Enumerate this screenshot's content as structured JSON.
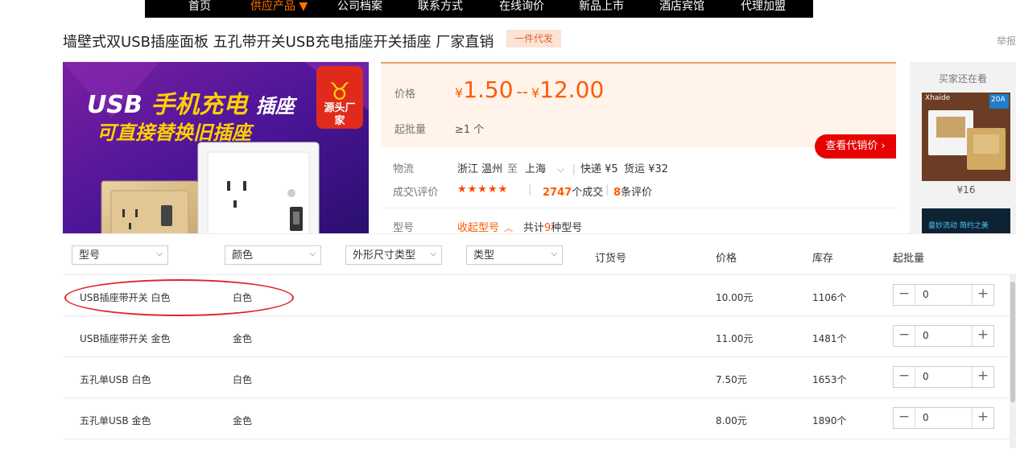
{
  "nav": [
    "首页",
    "供应产品 ▼",
    "公司档案",
    "联系方式",
    "在线询价",
    "新品上市",
    "酒店宾馆",
    "代理加盟"
  ],
  "title": "墙壁式双USB插座面板 五孔带开关USB充电插座开关插座 厂家直销",
  "badge": "一件代发",
  "report": "举报",
  "banner": {
    "line1_a": "USB",
    "line1_b": "手机充电",
    "line1_c": "插座",
    "line2": "可直接替换旧插座",
    "tag": "源头厂家"
  },
  "price": {
    "label": "价格",
    "currency": "¥",
    "min": "1.50",
    "sep": "--",
    "max": "12.00"
  },
  "moq": {
    "label": "起批量",
    "value": "≥1 个"
  },
  "agent_button": "查看代销价 ›",
  "logistics": {
    "label": "物流",
    "from": "浙江 温州",
    "to_label": "至",
    "to": "上海",
    "express": "快递 ¥5",
    "freight": "货运 ¥32"
  },
  "deal": {
    "label": "成交\\评价",
    "stars": "★★★★★",
    "count": "2747",
    "count_unit": "个成交",
    "reviews": "8",
    "reviews_unit": "条评价"
  },
  "model": {
    "label": "型号",
    "toggle": "收起型号",
    "total_prefix": "共计",
    "total_num": "9",
    "total_suffix": "种型号"
  },
  "side": {
    "title": "买家还在看",
    "thumb_brand": "Xhaide",
    "thumb_badge": "20A",
    "price": "¥16",
    "thumb2_text": "曼妙流动 简约之美"
  },
  "filters": {
    "model": "型号",
    "color": "颜色",
    "size": "外形尺寸类型",
    "type": "类型"
  },
  "headers": {
    "order": "订货号",
    "price": "价格",
    "stock": "库存",
    "moq": "起批量"
  },
  "rows": [
    {
      "model": "USB插座带开关 白色",
      "color": "白色",
      "price": "10.00元",
      "stock": "1106个",
      "qty": "0"
    },
    {
      "model": "USB插座带开关 金色",
      "color": "金色",
      "price": "11.00元",
      "stock": "1481个",
      "qty": "0"
    },
    {
      "model": "五孔单USB 白色",
      "color": "白色",
      "price": "7.50元",
      "stock": "1653个",
      "qty": "0"
    },
    {
      "model": "五孔单USB 金色",
      "color": "金色",
      "price": "8.00元",
      "stock": "1890个",
      "qty": "0"
    }
  ],
  "colors": {
    "accent": "#ff5a00",
    "nav_bg": "#000000",
    "agent_btn": "#e60000",
    "highlight": "#e0242a"
  }
}
